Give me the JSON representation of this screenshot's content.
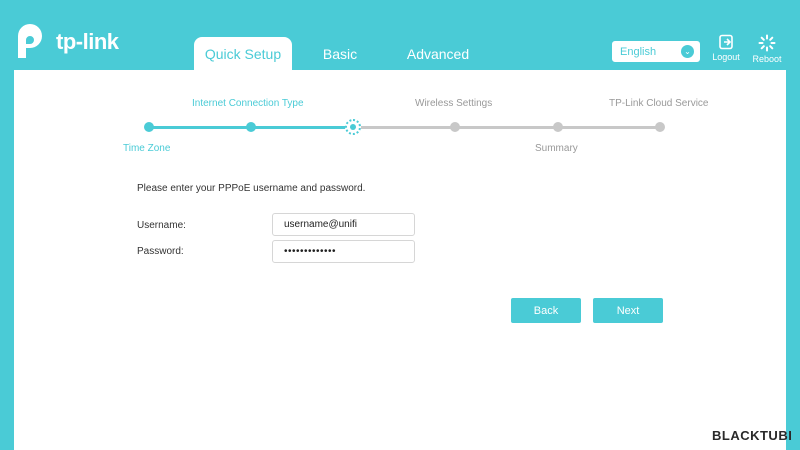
{
  "brand": {
    "name": "tp-link",
    "accent": "#4acbd6"
  },
  "nav": {
    "tabs": [
      {
        "label": "Quick Setup",
        "active": true
      },
      {
        "label": "Basic",
        "active": false
      },
      {
        "label": "Advanced",
        "active": false
      }
    ]
  },
  "toolbar": {
    "language": "English",
    "logout_label": "Logout",
    "reboot_label": "Reboot"
  },
  "stepper": {
    "steps": [
      {
        "label": "Time Zone",
        "state": "done"
      },
      {
        "label": "Internet Connection Type",
        "state": "done"
      },
      {
        "label": "",
        "state": "current"
      },
      {
        "label": "Wireless Settings",
        "state": "todo"
      },
      {
        "label": "Summary",
        "state": "todo"
      },
      {
        "label": "TP-Link Cloud Service",
        "state": "todo"
      }
    ]
  },
  "form": {
    "intro": "Please enter your PPPoE username and password.",
    "username_label": "Username:",
    "username_value": "username@unifi",
    "password_label": "Password:",
    "password_value": "•••••••••••••"
  },
  "actions": {
    "back_label": "Back",
    "next_label": "Next"
  },
  "watermark": "BLACKTUBI"
}
